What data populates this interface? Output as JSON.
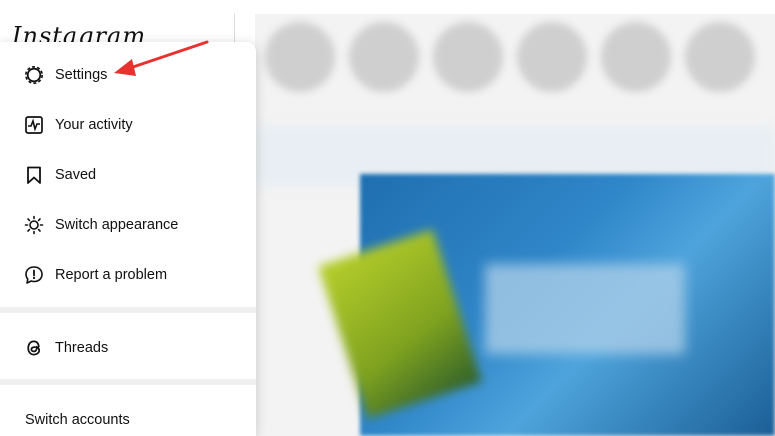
{
  "app": {
    "logo": "Instagram"
  },
  "menu": {
    "items": [
      {
        "label": "Settings",
        "icon": "settings-gear-icon"
      },
      {
        "label": "Your activity",
        "icon": "activity-icon"
      },
      {
        "label": "Saved",
        "icon": "bookmark-icon"
      },
      {
        "label": "Switch appearance",
        "icon": "sun-icon"
      },
      {
        "label": "Report a problem",
        "icon": "report-icon"
      }
    ],
    "threads": {
      "label": "Threads",
      "icon": "threads-icon"
    },
    "switch_accounts": "Switch accounts"
  },
  "annotation": {
    "arrow_color": "#e8322f"
  }
}
